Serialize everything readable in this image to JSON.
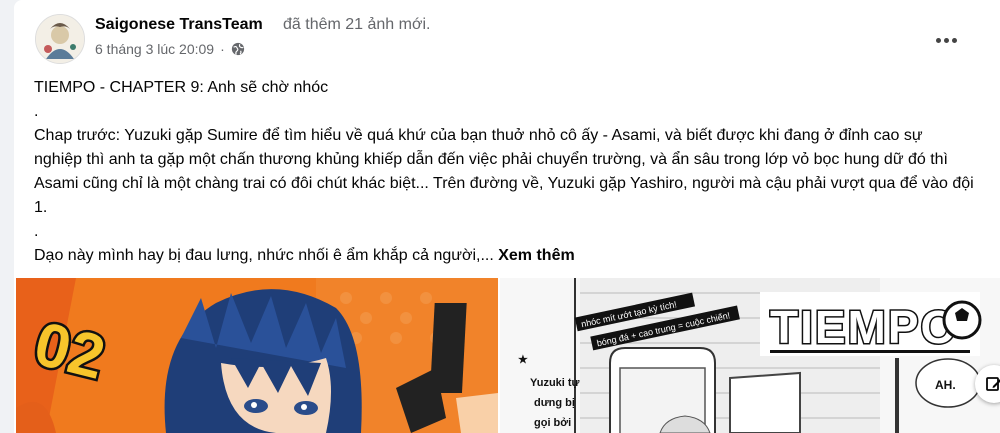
{
  "post": {
    "page_name": "Saigonese TransTeam",
    "action": "đã thêm 21 ảnh mới.",
    "timestamp": "6 tháng 3 lúc 20:09",
    "separator": "·",
    "privacy_icon": "globe-icon",
    "more_icon": "more-options-icon",
    "text_lines": [
      "TIEMPO - CHAPTER 9: Anh sẽ chờ nhóc",
      ".",
      "Chap trước: Yuzuki gặp Sumire để tìm hiểu về quá khứ của bạn thuở nhỏ cô ấy -  Asami, và biết được khi đang ở đỉnh cao sự nghiệp thì anh ta gặp một chấn thương khủng khiếp dẫn đến việc phải chuyển trường, và ẩn sâu trong lớp vỏ bọc hung dữ đó thì Asami cũng chỉ là một chàng trai có đôi chút khác biệt... Trên đường về, Yuzuki gặp Yashiro, người mà cậu phải vượt qua để vào đội 1.",
      "."
    ],
    "last_line": "Dạo này mình hay bị đau lưng, nhức nhối ê ẩm khắp cả người,...",
    "see_more": "Xem thêm"
  },
  "photos": {
    "left": {
      "number": "02"
    },
    "right": {
      "logo": "TIEMPO",
      "banner_line1": "nhóc mít ướt tạo kỳ tích!",
      "banner_line2": "bóng đá + cao trung = cuộc chiến!",
      "side_text_1": "Yuzuki tự",
      "side_text_2": "dưng bị",
      "side_text_3": "gọi bởi",
      "speech": "AH."
    }
  },
  "colors": {
    "accent_orange": "#f07a1e",
    "text": "#050505",
    "secondary_text": "#65676b"
  }
}
